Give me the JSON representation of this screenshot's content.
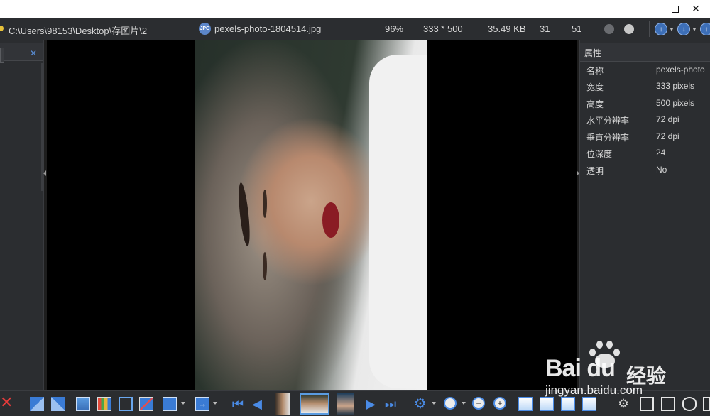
{
  "window": {
    "minimize": "—",
    "maximize": "□",
    "close": "✕"
  },
  "infobar": {
    "path": "C:\\Users\\98153\\Desktop\\存图片\\2",
    "file_icon": "JPG",
    "filename": "pexels-photo-1804514.jpg",
    "zoom": "96%",
    "dimensions": "333 * 500",
    "filesize": "35.49 KB",
    "index": "31",
    "total": "51"
  },
  "left_panel": {
    "close": "✕"
  },
  "properties": {
    "title": "属性",
    "rows": [
      {
        "key": "名称",
        "value": "pexels-photo"
      },
      {
        "key": "宽度",
        "value": "333 pixels"
      },
      {
        "key": "高度",
        "value": "500 pixels"
      },
      {
        "key": "水平分辨率",
        "value": "72 dpi"
      },
      {
        "key": "垂直分辨率",
        "value": "72 dpi"
      },
      {
        "key": "位深度",
        "value": "24"
      },
      {
        "key": "透明",
        "value": "No"
      }
    ]
  },
  "toolbar": {
    "delete": "✕",
    "first": "⏮",
    "prev": "◀",
    "next": "▶",
    "last": "⏭",
    "gear": "⚙",
    "zoom_out": "−",
    "zoom_in": "+"
  },
  "watermark": {
    "logo": "Bai du",
    "brand_cn": "经验",
    "url": "jingyan.baidu.com"
  },
  "colors": {
    "panel_bg": "#2b2d30",
    "accent": "#3a7bd5",
    "viewer_bg": "#000000",
    "text": "#d6d6d6"
  }
}
